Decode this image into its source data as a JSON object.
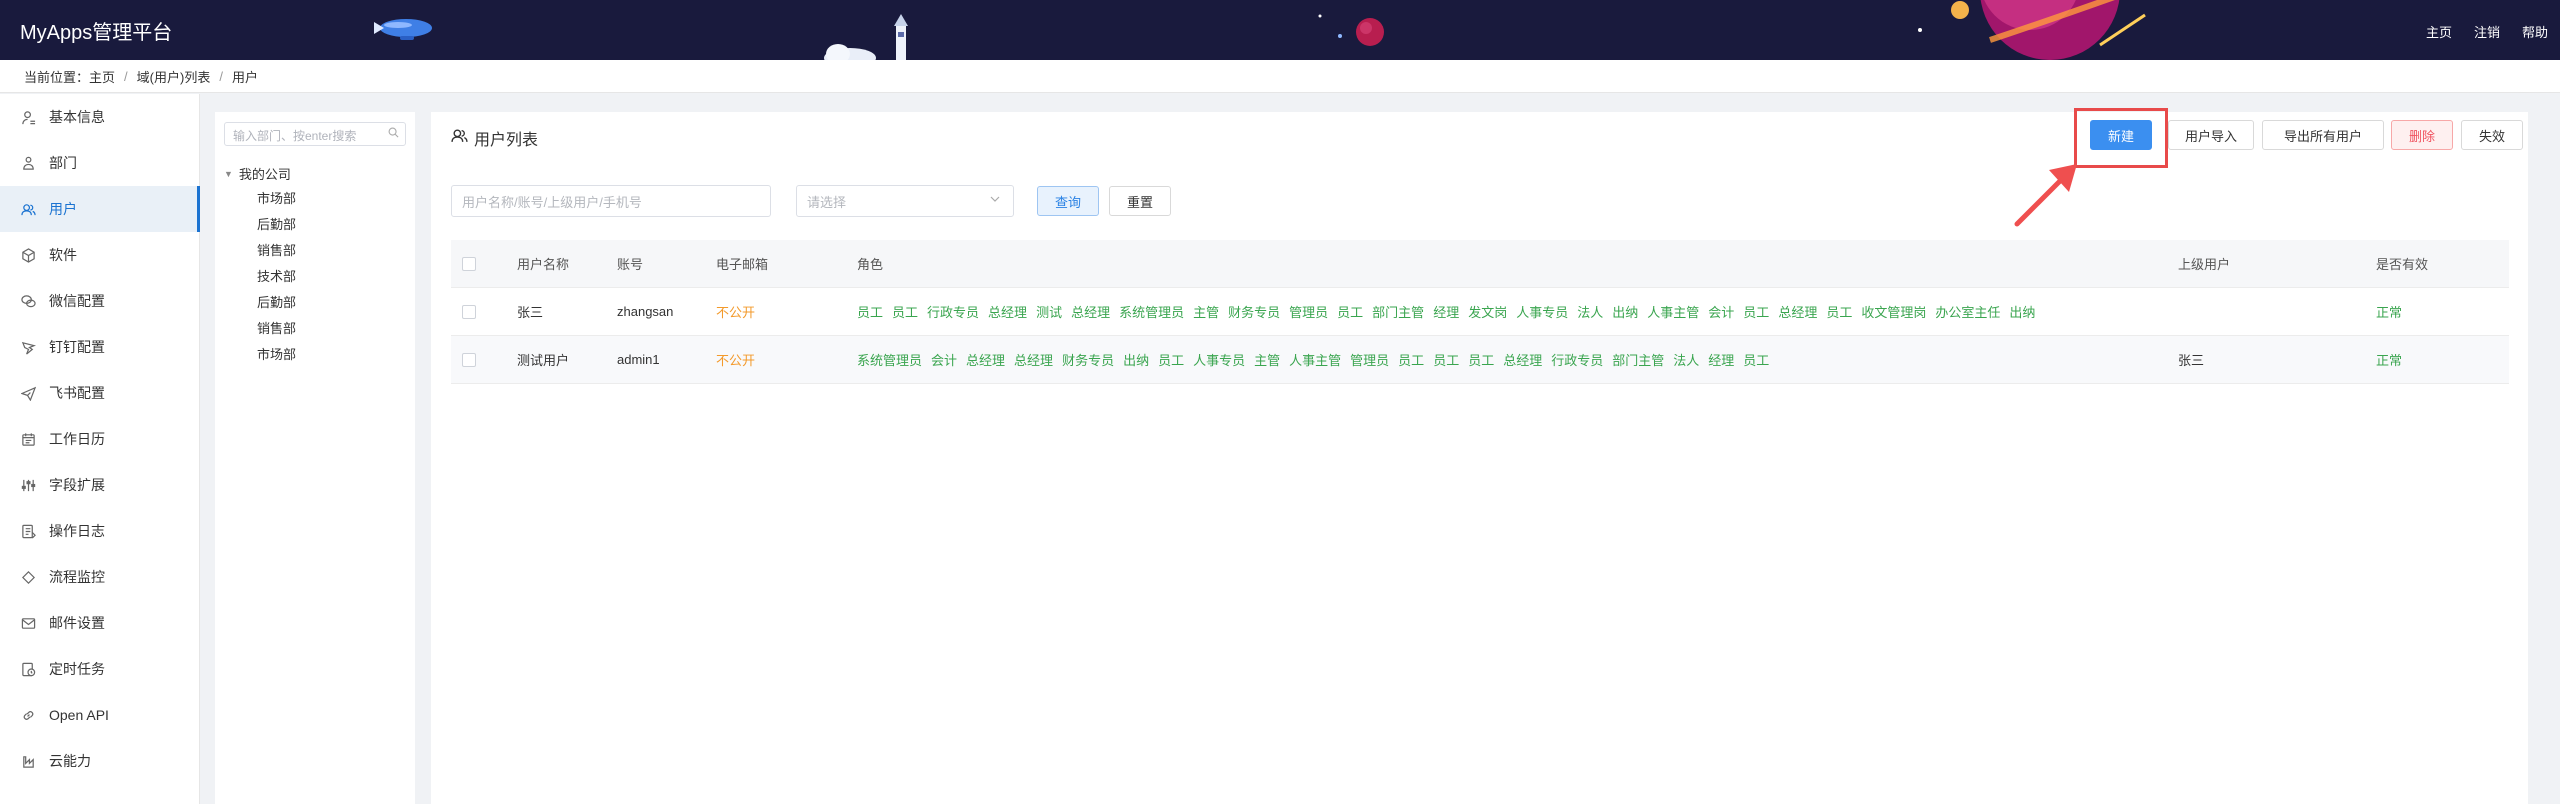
{
  "header": {
    "brand": "MyApps管理平台",
    "nav": [
      "主页",
      "注销",
      "帮助"
    ]
  },
  "breadcrumb": {
    "prefix": "当前位置：",
    "items": [
      "主页",
      "域(用户)列表",
      "用户"
    ]
  },
  "sidebar": {
    "items": [
      {
        "label": "基本信息",
        "icon": "user-info-icon"
      },
      {
        "label": "部门",
        "icon": "org-icon"
      },
      {
        "label": "用户",
        "icon": "users-icon",
        "active": true
      },
      {
        "label": "软件",
        "icon": "cube-icon"
      },
      {
        "label": "微信配置",
        "icon": "wechat-icon"
      },
      {
        "label": "钉钉配置",
        "icon": "dingtalk-icon"
      },
      {
        "label": "飞书配置",
        "icon": "feishu-icon"
      },
      {
        "label": "工作日历",
        "icon": "calendar-icon"
      },
      {
        "label": "字段扩展",
        "icon": "sliders-icon"
      },
      {
        "label": "操作日志",
        "icon": "log-icon"
      },
      {
        "label": "流程监控",
        "icon": "diamond-icon"
      },
      {
        "label": "邮件设置",
        "icon": "mail-icon"
      },
      {
        "label": "定时任务",
        "icon": "timer-icon"
      },
      {
        "label": "Open API",
        "icon": "link-icon"
      },
      {
        "label": "云能力",
        "icon": "cloud-icon"
      }
    ]
  },
  "tree": {
    "search_placeholder": "输入部门、按enter搜索",
    "root": "我的公司",
    "children": [
      "市场部",
      "后勤部",
      "销售部",
      "技术部",
      "后勤部",
      "销售部",
      "市场部"
    ]
  },
  "main": {
    "title": "用户列表",
    "buttons": {
      "new": "新建",
      "import": "用户导入",
      "export": "导出所有用户",
      "delete": "删除",
      "disable": "失效"
    },
    "search_placeholder": "用户名称/账号/上级用户/手机号",
    "select_placeholder": "请选择",
    "query": "查询",
    "reset": "重置",
    "columns": [
      "用户名称",
      "账号",
      "电子邮箱",
      "角色",
      "上级用户",
      "是否有效"
    ],
    "rows": [
      {
        "name": "张三",
        "account": "zhangsan",
        "email": "不公开",
        "roles": [
          "员工",
          "员工",
          "行政专员",
          "总经理",
          "测试",
          "总经理",
          "系统管理员",
          "主管",
          "财务专员",
          "管理员",
          "员工",
          "部门主管",
          "经理",
          "发文岗",
          "人事专员",
          "法人",
          "出纳",
          "人事主管",
          "会计",
          "员工",
          "总经理",
          "员工",
          "收文管理岗",
          "办公室主任",
          "出纳"
        ],
        "superior": "",
        "valid": "正常"
      },
      {
        "name": "测试用户",
        "account": "admin1",
        "email": "不公开",
        "roles": [
          "系统管理员",
          "会计",
          "总经理",
          "总经理",
          "财务专员",
          "出纳",
          "员工",
          "人事专员",
          "主管",
          "人事主管",
          "管理员",
          "员工",
          "员工",
          "员工",
          "总经理",
          "行政专员",
          "部门主管",
          "法人",
          "经理",
          "员工"
        ],
        "superior": "张三",
        "valid": "正常"
      }
    ]
  },
  "colors": {
    "header_bg": "#191a3d",
    "primary": "#3b8ff0",
    "role_green": "#3aa54f",
    "email_orange": "#f39a2b",
    "highlight_red": "#e84a4a"
  }
}
